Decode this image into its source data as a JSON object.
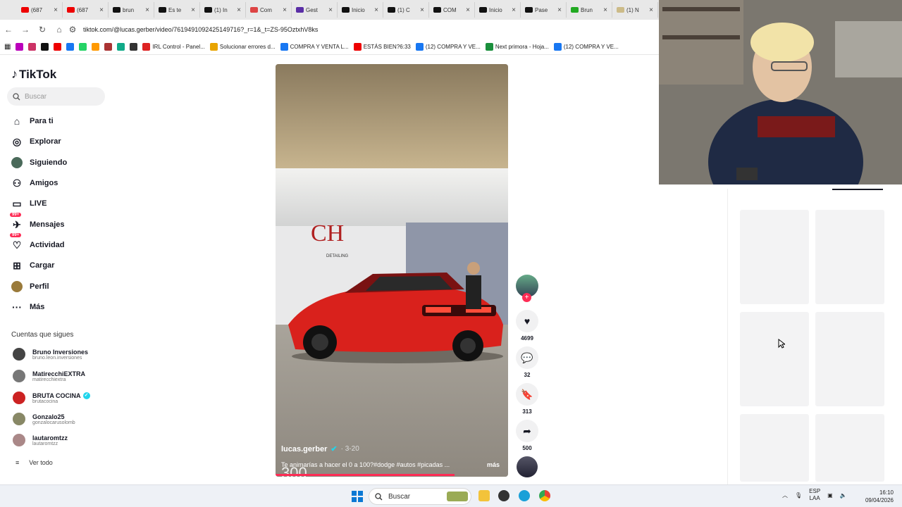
{
  "tabs": [
    {
      "title": "(687",
      "color": "#e00"
    },
    {
      "title": "(687",
      "color": "#e00"
    },
    {
      "title": "brun",
      "color": "#111"
    },
    {
      "title": "Es te",
      "color": "#111"
    },
    {
      "title": "(1) In",
      "color": "#111"
    },
    {
      "title": "Com",
      "color": "#d44"
    },
    {
      "title": "Gest",
      "color": "#5a2ea6"
    },
    {
      "title": "Inicio",
      "color": "#111"
    },
    {
      "title": "(1) C",
      "color": "#111"
    },
    {
      "title": "COM",
      "color": "#111"
    },
    {
      "title": "Inicio",
      "color": "#111"
    },
    {
      "title": "Pase",
      "color": "#111"
    },
    {
      "title": "Brun",
      "color": "#2a2"
    },
    {
      "title": "(1) N",
      "color": "#cb8"
    }
  ],
  "address": {
    "url": "tiktok.com/@lucas.gerber/video/7619491092425149716?_r=1&_t=ZS-95OztxhV8ks"
  },
  "bookmarks": [
    {
      "label": "",
      "color": "#b0b"
    },
    {
      "label": "",
      "color": "#c36"
    },
    {
      "label": "",
      "color": "#111"
    },
    {
      "label": "",
      "color": "#e00"
    },
    {
      "label": "",
      "color": "#1877f2"
    },
    {
      "label": "",
      "color": "#25d366"
    },
    {
      "label": "",
      "color": "#f90"
    },
    {
      "label": "",
      "color": "#a33"
    },
    {
      "label": "",
      "color": "#1a8"
    },
    {
      "label": "",
      "color": "#333"
    },
    {
      "label": "IRL Control - Panel...",
      "color": "#d22"
    },
    {
      "label": "Solucionar errores d...",
      "color": "#e8a400"
    },
    {
      "label": "COMPRA Y VENTA L...",
      "color": "#1877f2"
    },
    {
      "label": "ESTÁS BIEN?6:33",
      "color": "#e00"
    },
    {
      "label": "(12) COMPRA Y VE...",
      "color": "#1877f2"
    },
    {
      "label": "Next primora - Hoja...",
      "color": "#1a8f3c"
    },
    {
      "label": "(12) COMPRA Y VE...",
      "color": "#1877f2"
    }
  ],
  "sidebar": {
    "logo": "TikTok",
    "search_placeholder": "Buscar",
    "nav": [
      {
        "label": "Para ti",
        "icon": "home-icon"
      },
      {
        "label": "Explorar",
        "icon": "compass-icon"
      },
      {
        "label": "Siguiendo",
        "icon": "following-avatar-icon"
      },
      {
        "label": "Amigos",
        "icon": "friends-icon"
      },
      {
        "label": "LIVE",
        "icon": "live-icon"
      },
      {
        "label": "Mensajes",
        "icon": "messages-icon",
        "badge": "99+"
      },
      {
        "label": "Actividad",
        "icon": "activity-icon",
        "badge": "99+"
      },
      {
        "label": "Cargar",
        "icon": "upload-icon"
      },
      {
        "label": "Perfil",
        "icon": "profile-avatar-icon"
      },
      {
        "label": "Más",
        "icon": "more-icon"
      }
    ],
    "following_title": "Cuentas que sigues",
    "accounts": [
      {
        "name": "Bruno Inversiones",
        "handle": "bruno.leon.inversiones",
        "color": "#444"
      },
      {
        "name": "MatirecchiEXTRA",
        "handle": "matirecchiextra",
        "color": "#777"
      },
      {
        "name": "BRUTA COCINA",
        "handle": "brutacocina",
        "color": "#c22",
        "verified": "✓"
      },
      {
        "name": "Gonzalo25",
        "handle": "gonzalocarusolomb",
        "color": "#886"
      },
      {
        "name": "lautaromtzz",
        "handle": "lautaromtzz",
        "color": "#a88"
      }
    ],
    "see_all": "Ver todo"
  },
  "video": {
    "username": "lucas.gerber",
    "date": "· 3-20",
    "caption": "Te animarías a hacer el 0 a 100?#dodge #autos #picadas ...",
    "more": "más",
    "overlay_text": "300",
    "shop_logo": "CH",
    "shop_sub": "DETAILING",
    "progress": 0.77
  },
  "actions": [
    {
      "icon": "heart-icon",
      "count": "4699"
    },
    {
      "icon": "comment-icon",
      "count": "32"
    },
    {
      "icon": "bookmark-icon",
      "count": "313"
    },
    {
      "icon": "share-icon",
      "count": "500"
    }
  ],
  "taskbar": {
    "search": "Buscar",
    "lang_top": "ESP",
    "lang_bottom": "LAA",
    "time": "16:10",
    "date": "09/04/2026"
  },
  "colors": {
    "accent": "#fe2c55",
    "verified": "#20d5ec"
  }
}
